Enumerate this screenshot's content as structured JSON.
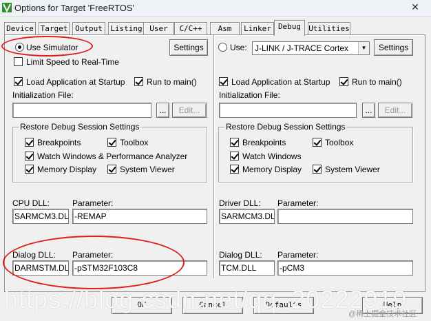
{
  "window": {
    "title": "Options for Target 'FreeRTOS'",
    "close_glyph": "✕"
  },
  "tabs": [
    {
      "label": "Device",
      "active": false
    },
    {
      "label": "Target",
      "active": false
    },
    {
      "label": "Output",
      "active": false
    },
    {
      "label": "Listing",
      "active": false
    },
    {
      "label": "User",
      "active": false
    },
    {
      "label": "C/C++",
      "active": false
    },
    {
      "label": "Asm",
      "active": false
    },
    {
      "label": "Linker",
      "active": false
    },
    {
      "label": "Debug",
      "active": true
    },
    {
      "label": "Utilities",
      "active": false
    }
  ],
  "left": {
    "use_simulator": {
      "label": "Use Simulator",
      "selected": true
    },
    "settings_label": "Settings",
    "limit_speed": {
      "label": "Limit Speed to Real-Time",
      "checked": false
    },
    "load_app": {
      "label": "Load Application at Startup",
      "checked": true
    },
    "run_to_main": {
      "label": "Run to main()",
      "checked": true
    },
    "init_file_label": "Initialization File:",
    "init_file_value": "",
    "browse_label": "...",
    "edit_label": "Edit...",
    "restore": {
      "title": "Restore Debug Session Settings",
      "breakpoints": {
        "label": "Breakpoints",
        "checked": true
      },
      "toolbox": {
        "label": "Toolbox",
        "checked": true
      },
      "watch": {
        "label": "Watch Windows & Performance Analyzer",
        "checked": true
      },
      "memory": {
        "label": "Memory Display",
        "checked": true
      },
      "sysviewer": {
        "label": "System Viewer",
        "checked": true
      }
    },
    "cpu_dll_label": "CPU DLL:",
    "cpu_dll_value": "SARMCM3.DLL",
    "cpu_param_label": "Parameter:",
    "cpu_param_value": "-REMAP",
    "dialog_dll_label": "Dialog DLL:",
    "dialog_dll_value": "DARMSTM.DLL",
    "dialog_param_label": "Parameter:",
    "dialog_param_value": "-pSTM32F103C8"
  },
  "right": {
    "use": {
      "label": "Use:",
      "selected": false
    },
    "debugger": "J-LINK / J-TRACE Cortex",
    "settings_label": "Settings",
    "load_app": {
      "label": "Load Application at Startup",
      "checked": true
    },
    "run_to_main": {
      "label": "Run to main()",
      "checked": true
    },
    "init_file_label": "Initialization File:",
    "init_file_value": "",
    "browse_label": "...",
    "edit_label": "Edit...",
    "restore": {
      "title": "Restore Debug Session Settings",
      "breakpoints": {
        "label": "Breakpoints",
        "checked": true
      },
      "toolbox": {
        "label": "Toolbox",
        "checked": true
      },
      "watch": {
        "label": "Watch Windows",
        "checked": true
      },
      "memory": {
        "label": "Memory Display",
        "checked": true
      },
      "sysviewer": {
        "label": "System Viewer",
        "checked": true
      }
    },
    "driver_dll_label": "Driver DLL:",
    "driver_dll_value": "SARMCM3.DLL",
    "driver_param_label": "Parameter:",
    "driver_param_value": "",
    "dialog_dll_label": "Dialog DLL:",
    "dialog_dll_value": "TCM.DLL",
    "dialog_param_label": "Parameter:",
    "dialog_param_value": "-pCM3"
  },
  "footer": {
    "ok_label": "OK",
    "cancel_label": "Cancel",
    "defaults_label": "Defaults",
    "help_label": "Help"
  },
  "overlay": {
    "watermark": "https://blog.csdn.net/qq_20222919",
    "watermark_corner": "@稀土掘金技术社区"
  },
  "colors": {
    "annotation": "#e21b1b",
    "window_bg": "#f0f0f0",
    "title_bg": "#eef2f7"
  }
}
